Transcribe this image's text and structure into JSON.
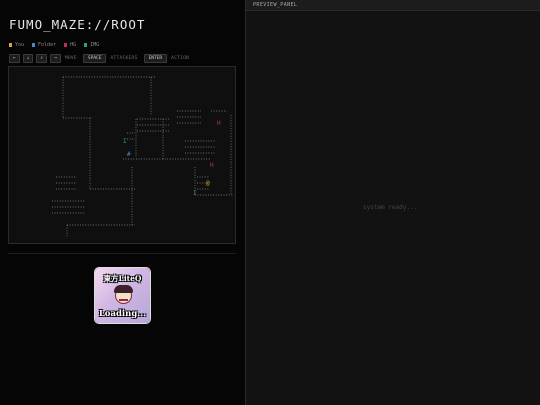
{
  "app": {
    "title": "FUMO_MAZE://ROOT"
  },
  "legend": [
    {
      "label": "You",
      "color": "#d4a83d"
    },
    {
      "label": "Folder",
      "color": "#4a86c8"
    },
    {
      "label": "HG",
      "color": "#c0304c"
    },
    {
      "label": "IMG",
      "color": "#3a9a6a"
    }
  ],
  "controls": {
    "keys": [
      "←",
      "↓",
      "↑",
      "→"
    ],
    "move_label": "MOVE",
    "space_key": "SPACE",
    "space_label": "ATTACKERS",
    "enter_key": "ENTER",
    "enter_label": "ACTION"
  },
  "loading": {
    "title": "東方LiteQ",
    "text": "Loading..."
  },
  "preview": {
    "header": "PREVIEW_PANEL",
    "status": "system ready..."
  },
  "colors": {
    "maze_dots": "#7a7a7a",
    "player": "#d4a83d",
    "folder": "#4a86c8",
    "hg": "#c0304c",
    "img": "#3a9a6a"
  }
}
